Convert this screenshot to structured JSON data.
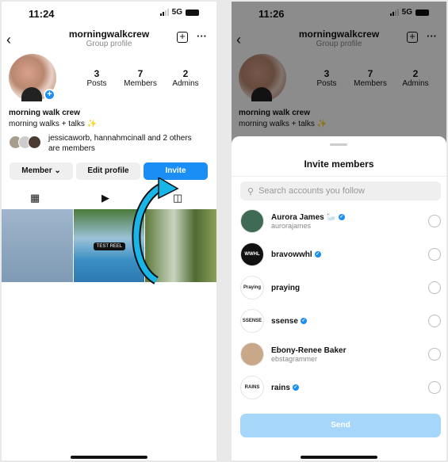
{
  "left": {
    "status": {
      "time": "11:24",
      "network": "5G"
    },
    "header": {
      "title": "morningwalkcrew",
      "subtitle": "Group profile"
    },
    "stats": [
      {
        "value": "3",
        "label": "Posts"
      },
      {
        "value": "7",
        "label": "Members"
      },
      {
        "value": "2",
        "label": "Admins"
      }
    ],
    "bio": {
      "name": "morning walk crew",
      "text": "morning walks + talks ✨",
      "members_line1": "jessicaworb, hannahmcinall and 2 others",
      "members_line2": "are members"
    },
    "buttons": {
      "member": "Member ⌄",
      "edit": "Edit profile",
      "invite": "Invite"
    },
    "grid": {
      "reel_badge": "TEST REEL"
    },
    "accent": "#1a8ef5"
  },
  "right": {
    "status": {
      "time": "11:26",
      "network": "5G"
    },
    "header": {
      "title": "morningwalkcrew",
      "subtitle": "Group profile"
    },
    "stats": [
      {
        "value": "3",
        "label": "Posts"
      },
      {
        "value": "7",
        "label": "Members"
      },
      {
        "value": "2",
        "label": "Admins"
      }
    ],
    "bio": {
      "name": "morning walk crew",
      "text": "morning walks + talks ✨"
    },
    "sheet": {
      "title": "Invite members",
      "search_placeholder": "Search accounts you follow",
      "accounts": [
        {
          "name": "Aurora James 🦢",
          "handle": "aurorajames",
          "verified": true,
          "avatar_text": "",
          "avatar_bg": "#3f6b55"
        },
        {
          "name": "bravowwhl",
          "handle": "",
          "verified": true,
          "avatar_text": "WWHL",
          "avatar_bg": "#111111"
        },
        {
          "name": "praying",
          "handle": "",
          "verified": false,
          "avatar_text": "Praying",
          "avatar_bg": "#ffffff"
        },
        {
          "name": "ssense",
          "handle": "",
          "verified": true,
          "avatar_text": "SSENSE",
          "avatar_bg": "#ffffff"
        },
        {
          "name": "Ebony-Renee Baker",
          "handle": "ebstagrammer",
          "verified": false,
          "avatar_text": "",
          "avatar_bg": "#c9a88a"
        },
        {
          "name": "rains",
          "handle": "",
          "verified": true,
          "avatar_text": "RAINS",
          "avatar_bg": "#ffffff"
        }
      ],
      "send": "Send"
    }
  }
}
